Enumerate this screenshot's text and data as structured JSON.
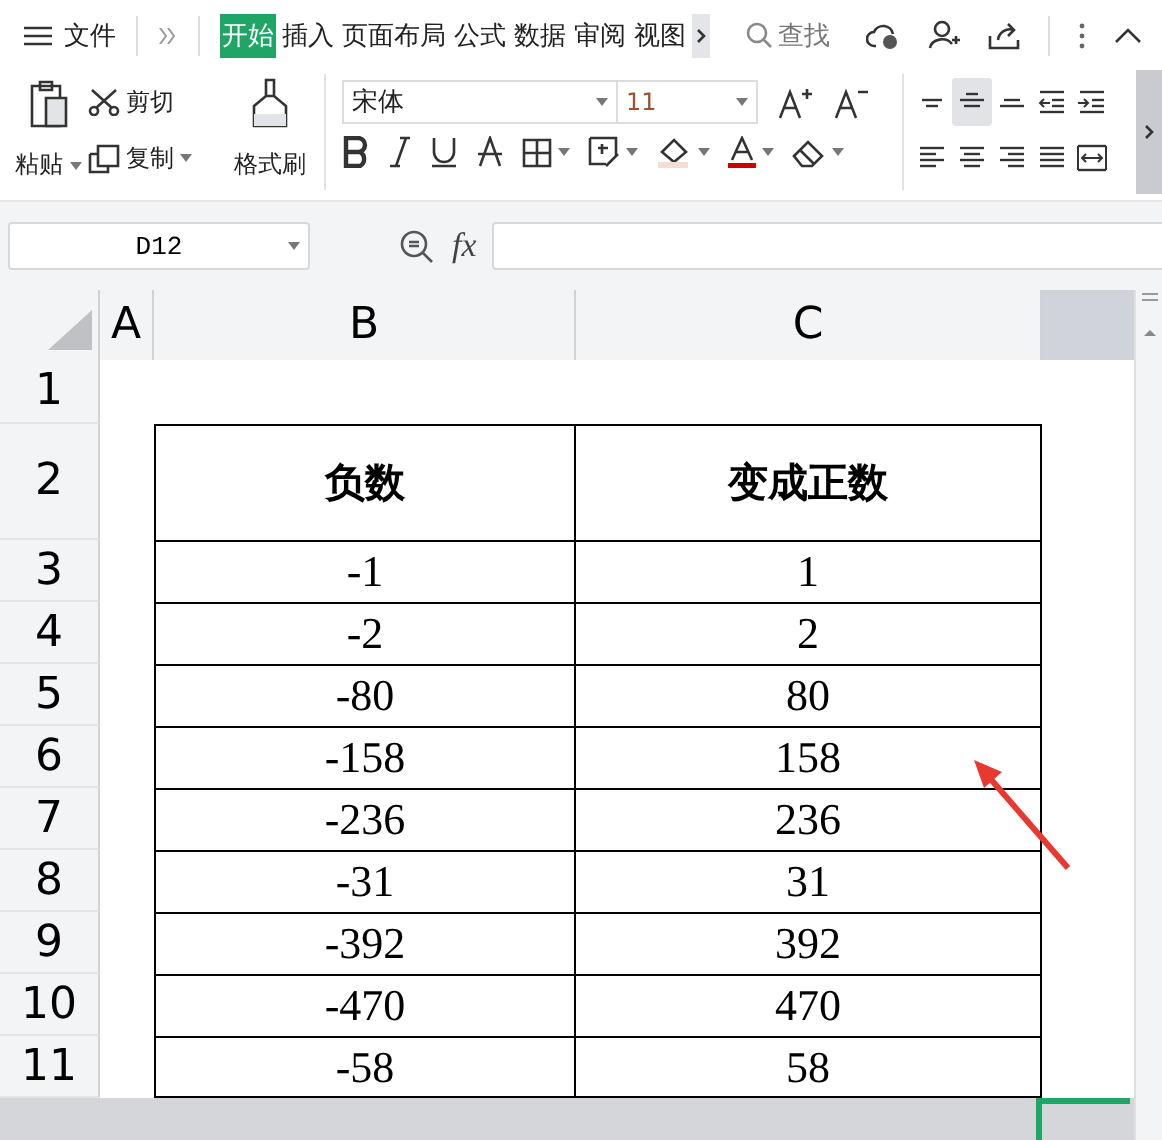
{
  "menu": {
    "file": "文件",
    "tabs": [
      {
        "label": "开始",
        "selected": true
      },
      {
        "label": "插入",
        "selected": false
      },
      {
        "label": "页面布局",
        "selected": false
      },
      {
        "label": "公式",
        "selected": false
      },
      {
        "label": "数据",
        "selected": false
      },
      {
        "label": "审阅",
        "selected": false
      },
      {
        "label": "视图",
        "selected": false
      }
    ],
    "search": "查找"
  },
  "toolbar": {
    "paste": "粘贴",
    "cut": "剪切",
    "copy": "复制",
    "format_painter": "格式刷",
    "font": "宋体",
    "font_size": "11",
    "align_center_selected": true
  },
  "formula_bar": {
    "name_box": "D12",
    "fx": "fx"
  },
  "sheet": {
    "columns": [
      {
        "label": "A",
        "selected": false
      },
      {
        "label": "B",
        "selected": false
      },
      {
        "label": "C",
        "selected": false
      },
      {
        "selected": true
      }
    ],
    "rows": [
      {
        "header": "1",
        "kind": "blank"
      },
      {
        "header": "2",
        "kind": "heading",
        "cells": [
          "负数",
          "变成正数"
        ]
      },
      {
        "header": "3",
        "kind": "value",
        "cells": [
          "-1",
          "1"
        ]
      },
      {
        "header": "4",
        "kind": "value",
        "cells": [
          "-2",
          "2"
        ]
      },
      {
        "header": "5",
        "kind": "value",
        "cells": [
          "-80",
          "80"
        ]
      },
      {
        "header": "6",
        "kind": "value",
        "cells": [
          "-158",
          "158"
        ]
      },
      {
        "header": "7",
        "kind": "value",
        "cells": [
          "-236",
          "236"
        ]
      },
      {
        "header": "8",
        "kind": "value",
        "cells": [
          "-31",
          "31"
        ]
      },
      {
        "header": "9",
        "kind": "value",
        "cells": [
          "-392",
          "392"
        ]
      },
      {
        "header": "10",
        "kind": "value",
        "cells": [
          "-470",
          "470"
        ]
      },
      {
        "header": "11",
        "kind": "value",
        "cells": [
          "-58",
          "58"
        ]
      }
    ]
  }
}
